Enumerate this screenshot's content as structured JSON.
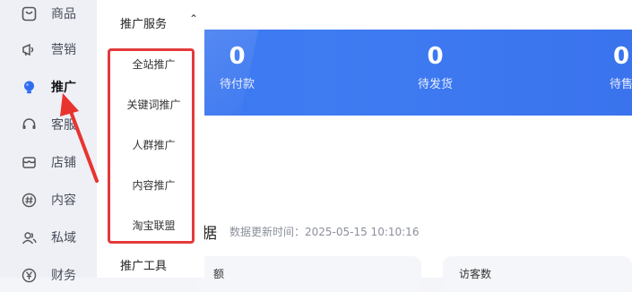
{
  "sidebar": {
    "items": [
      {
        "label": "商品",
        "icon": "product-icon"
      },
      {
        "label": "营销",
        "icon": "megaphone-icon"
      },
      {
        "label": "推广",
        "icon": "lightbulb-icon",
        "active": true
      },
      {
        "label": "客服",
        "icon": "headset-icon"
      },
      {
        "label": "店铺",
        "icon": "store-icon"
      },
      {
        "label": "内容",
        "icon": "hashtag-icon"
      },
      {
        "label": "私域",
        "icon": "users-icon"
      },
      {
        "label": "财务",
        "icon": "yen-icon"
      }
    ]
  },
  "promo_menu": {
    "title": "推广服务",
    "items": [
      "全站推广",
      "关键词推广",
      "人群推广",
      "内容推广",
      "淘宝联盟"
    ],
    "tools_label": "推广工具"
  },
  "stats": [
    {
      "value": "0",
      "label": "待付款"
    },
    {
      "value": "0",
      "label": "待发货"
    },
    {
      "value": "0",
      "label": "待售"
    }
  ],
  "data_section": {
    "header_fragment": "据",
    "update_time": "数据更新时间：2025-05-15 10:10:16"
  },
  "cards": [
    {
      "title": "额"
    },
    {
      "title": "访客数"
    }
  ],
  "colors": {
    "accent": "#3a74ee",
    "highlight_border": "#e4393c",
    "arrow": "#e8342f"
  }
}
